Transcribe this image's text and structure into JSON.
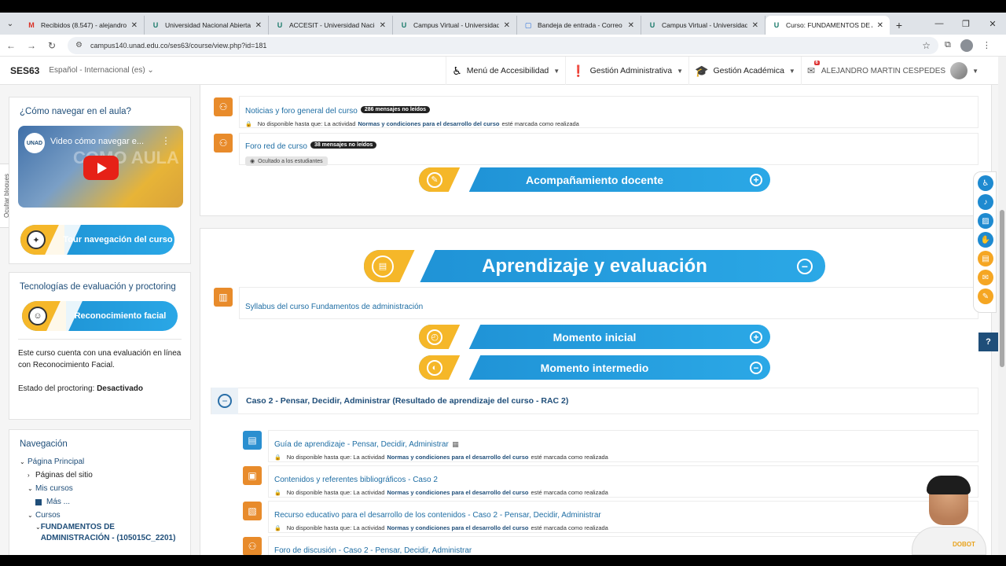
{
  "browser": {
    "tabs": [
      {
        "label": "Recibidos (8.547) - alejandro.m",
        "icon": "gmail-icon"
      },
      {
        "label": "Universidad Nacional Abierta y",
        "icon": "unad-icon"
      },
      {
        "label": "ACCESIT - Universidad Naciona",
        "icon": "unad-icon"
      },
      {
        "label": "Campus Virtual - Universidad N",
        "icon": "unad-icon"
      },
      {
        "label": "Bandeja de entrada - Correo",
        "icon": "mail-icon"
      },
      {
        "label": "Campus Virtual - Universidad N",
        "icon": "unad-icon"
      },
      {
        "label": "Curso: FUNDAMENTOS DE ADM",
        "icon": "unad-icon"
      }
    ],
    "url": "campus140.unad.edu.co/ses63/course/view.php?id=181"
  },
  "navbar": {
    "brand": "SES63",
    "language": "Español - Internacional (es)",
    "accessibility_menu": "Menú de Accesibilidad",
    "admin_menu": "Gestión Administrativa",
    "academic_menu": "Gestión Académica",
    "user_name": "ALEJANDRO MARTIN CESPEDES",
    "mail_count": "6"
  },
  "left": {
    "hide_blocks": "Ocultar bloques",
    "how_to": {
      "title": "¿Cómo navegar en el aula?",
      "video_title": "Video cómo navegar e...",
      "video_logo": "UNAD",
      "video_overlay": "COMO AULA",
      "tour_label": "Tour navegación del curso"
    },
    "proctoring": {
      "title": "Tecnologías de evaluación y proctoring",
      "button_label": "Reconocimiento facial",
      "description": "Este curso cuenta con una evaluación en línea con Reconocimiento Facial.",
      "status_label": "Estado del proctoring:",
      "status_value": "Desactivado"
    },
    "navigation": {
      "title": "Navegación",
      "items": [
        "Página Principal",
        "Páginas del sitio",
        "Mis cursos",
        "Más ...",
        "Cursos",
        "FUNDAMENTOS DE ADMINISTRACIÓN - (105015C_2201)"
      ]
    }
  },
  "main": {
    "news_forum": "Noticias y foro general del curso",
    "news_badge": "286 mensajes no leídos",
    "course_forum": "Foro red de curso",
    "course_forum_badge": "38 mensajes no leídos",
    "hidden_label": "Ocultado a los estudiantes",
    "restriction_prefix": "No disponible hasta que: La actividad",
    "restriction_activity": "Normas y condiciones para el desarrollo del curso",
    "restriction_suffix": "esté marcada como realizada",
    "acompanamiento": "Acompañamiento docente",
    "aprendizaje": "Aprendizaje y evaluación",
    "syllabus": "Syllabus del curso Fundamentos de administración",
    "momento_inicial": "Momento inicial",
    "momento_intermedio": "Momento intermedio",
    "case_title": "Caso 2 - Pensar, Decidir, Administrar (Resultado de aprendizaje del curso - RAC 2)",
    "activities": [
      "Guía de aprendizaje - Pensar, Decidir, Administrar",
      "Contenidos y referentes bibliográficos - Caso 2",
      "Recurso educativo para el desarrollo de los contenidos - Caso 2 - Pensar, Decidir, Administrar",
      "Foro de discusión - Caso 2 - Pensar, Decidir, Administrar"
    ]
  },
  "bot": {
    "label": "DOBOT"
  },
  "help": "?"
}
